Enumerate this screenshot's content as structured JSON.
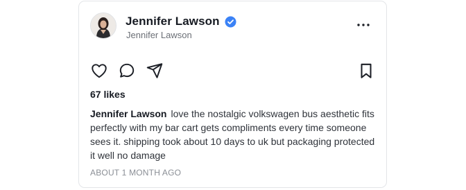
{
  "post": {
    "display_name": "Jennifer Lawson",
    "handle": "Jennifer Lawson",
    "verified": true,
    "likes": "67 likes",
    "caption_author": "Jennifer Lawson",
    "caption_text": "love the nostalgic volkswagen bus aesthetic fits perfectly with my bar cart gets compliments every time someone sees it. shipping took about 10 days to uk but packaging protected it well no damage",
    "timestamp": "ABOUT 1 MONTH AGO"
  },
  "icons": {
    "verified": "verified-badge-icon",
    "more": "more-options-icon",
    "like": "heart-icon",
    "comment": "comment-icon",
    "share": "send-icon",
    "save": "bookmark-icon"
  },
  "colors": {
    "verified_blue": "#3b82f6",
    "text_primary": "#161a22",
    "text_secondary": "#6b6f76"
  }
}
